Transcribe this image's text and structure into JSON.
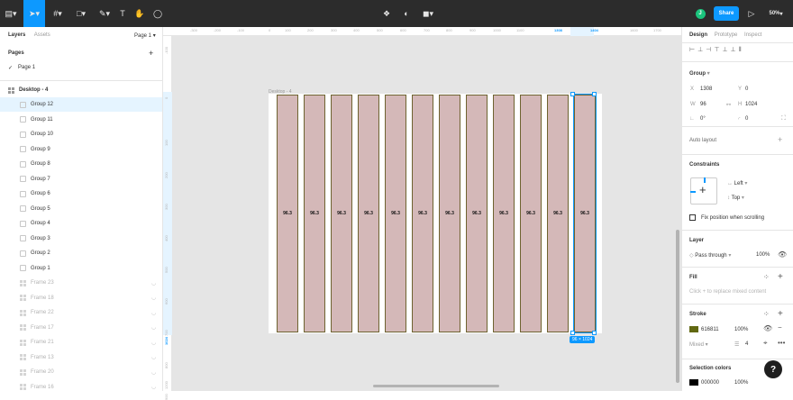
{
  "toolbar": {
    "share": "Share",
    "zoom": "50%",
    "avatar": "J"
  },
  "left": {
    "tabs": [
      "Layers",
      "Assets"
    ],
    "page_select": "Page 1",
    "pages_title": "Pages",
    "add": "+",
    "page_item": "Page 1",
    "frame": "Desktop - 4",
    "groups": [
      "Group 12",
      "Group 11",
      "Group 10",
      "Group 9",
      "Group 8",
      "Group 7",
      "Group 6",
      "Group 5",
      "Group 4",
      "Group 3",
      "Group 2",
      "Group 1"
    ],
    "hidden_frames": [
      "Frame 23",
      "Frame 18",
      "Frame 22",
      "Frame 17",
      "Frame 21",
      "Frame 13",
      "Frame 20",
      "Frame 16"
    ]
  },
  "ruler": {
    "top": [
      "-300",
      "-200",
      "-100",
      "0",
      "100",
      "200",
      "300",
      "400",
      "500",
      "600",
      "700",
      "800",
      "900",
      "1000",
      "1100",
      "1308",
      "1404",
      "1600",
      "1700"
    ],
    "left": [
      "-100",
      "0",
      "100",
      "200",
      "300",
      "400",
      "500",
      "600",
      "700",
      "800",
      "900",
      "1024",
      "1200"
    ]
  },
  "canvas": {
    "frame_label": "Desktop - 4",
    "column_value": "96.3",
    "size_badge": "96 × 1024"
  },
  "right": {
    "tabs": [
      "Design",
      "Prototype",
      "Inspect"
    ],
    "group_title": "Group",
    "x_label": "X",
    "x_value": "1308",
    "y_label": "Y",
    "y_value": "0",
    "w_label": "W",
    "w_value": "96",
    "h_label": "H",
    "h_value": "1024",
    "rot_value": "0°",
    "radius_value": "0",
    "auto_layout": "Auto layout",
    "constraints": "Constraints",
    "constraint_h": "Left",
    "constraint_v": "Top",
    "fix_position": "Fix position when scrolling",
    "layer": "Layer",
    "blend": "Pass through",
    "layer_opacity": "100%",
    "fill": "Fill",
    "fill_hint": "Click + to replace mixed content",
    "stroke": "Stroke",
    "stroke_hex": "616811",
    "stroke_opacity": "100%",
    "stroke_align": "Mixed",
    "stroke_weight": "4",
    "selection_colors": "Selection colors",
    "sel_hex": "000000",
    "sel_opacity": "100%",
    "help": "?"
  },
  "colors": {
    "accent": "#0d99ff",
    "toolbar": "#2c2c2c",
    "column_fill": "#d4b8b8",
    "stroke": "#616811"
  }
}
